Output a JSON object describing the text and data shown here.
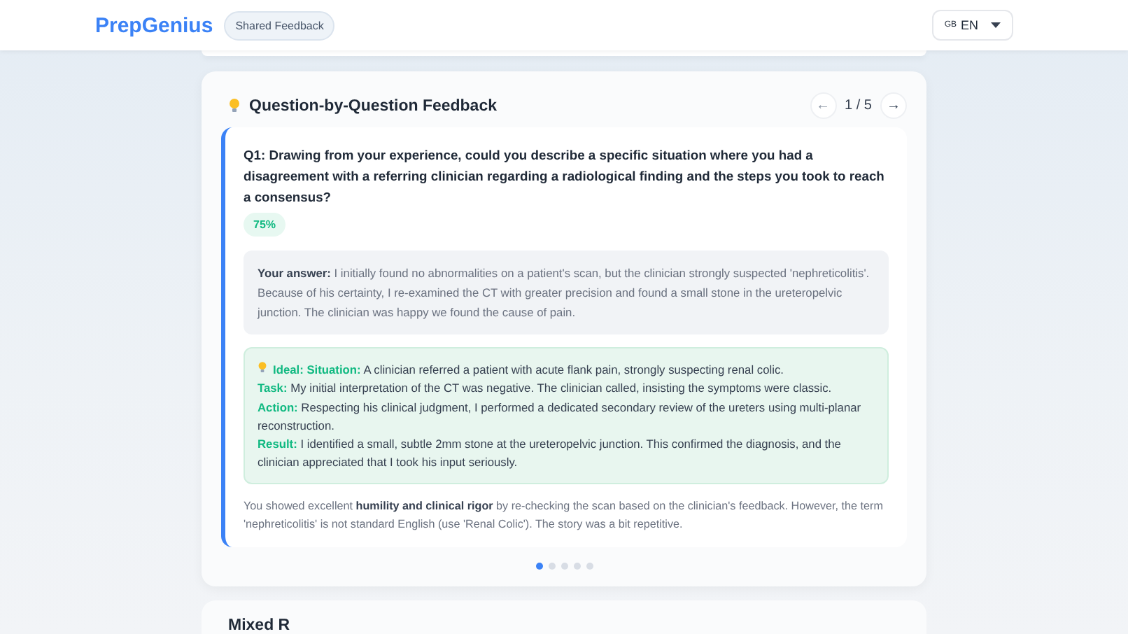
{
  "header": {
    "logo": "PrepGenius",
    "badge": "Shared Feedback",
    "language": {
      "flag": "GB",
      "code": "EN"
    }
  },
  "feedback_card": {
    "title": "Question-by-Question Feedback",
    "pager": {
      "prev": "←",
      "position": "1 / 5",
      "next": "→",
      "prev_disabled": true
    },
    "question": {
      "text": "Q1: Drawing from your experience, could you describe a specific situation where you had a disagreement with a referring clinician regarding a radiological finding and the steps you took to reach a consensus?",
      "score": "75%",
      "answer_label": "Your answer:",
      "answer": "I initially found no abnormalities on a patient's scan, but the clinician strongly suspected 'nephreticolitis'. Because of his certainty, I re-examined the CT with greater precision and found a small stone in the ureteropelvic junction. The clinician was happy we found the cause of pain.",
      "ideal_label": "Ideal:",
      "ideal_sections": [
        {
          "label": "Situation:",
          "text": "A clinician referred a patient with acute flank pain, strongly suspecting renal colic."
        },
        {
          "label": "Task:",
          "text": "My initial interpretation of the CT was negative. The clinician called, insisting the symptoms were classic."
        },
        {
          "label": "Action:",
          "text": "Respecting his clinical judgment, I performed a dedicated secondary review of the ureters using multi-planar reconstruction."
        },
        {
          "label": "Result:",
          "text": "I identified a small, subtle 2mm stone at the ureteropelvic junction. This confirmed the diagnosis, and the clinician appreciated that I took his input seriously."
        }
      ],
      "comment": "You showed excellent **humility and clinical rigor** by re-checking the scan based on the clinician's feedback. However, the term 'nephreticolitis' is not standard English (use 'Renal Colic'). The story was a bit repetitive."
    },
    "dots": [
      {
        "selected": true
      },
      {
        "selected": false
      },
      {
        "selected": false
      },
      {
        "selected": false
      },
      {
        "selected": false
      }
    ]
  },
  "next_card": {
    "title": "Mixed R"
  }
}
